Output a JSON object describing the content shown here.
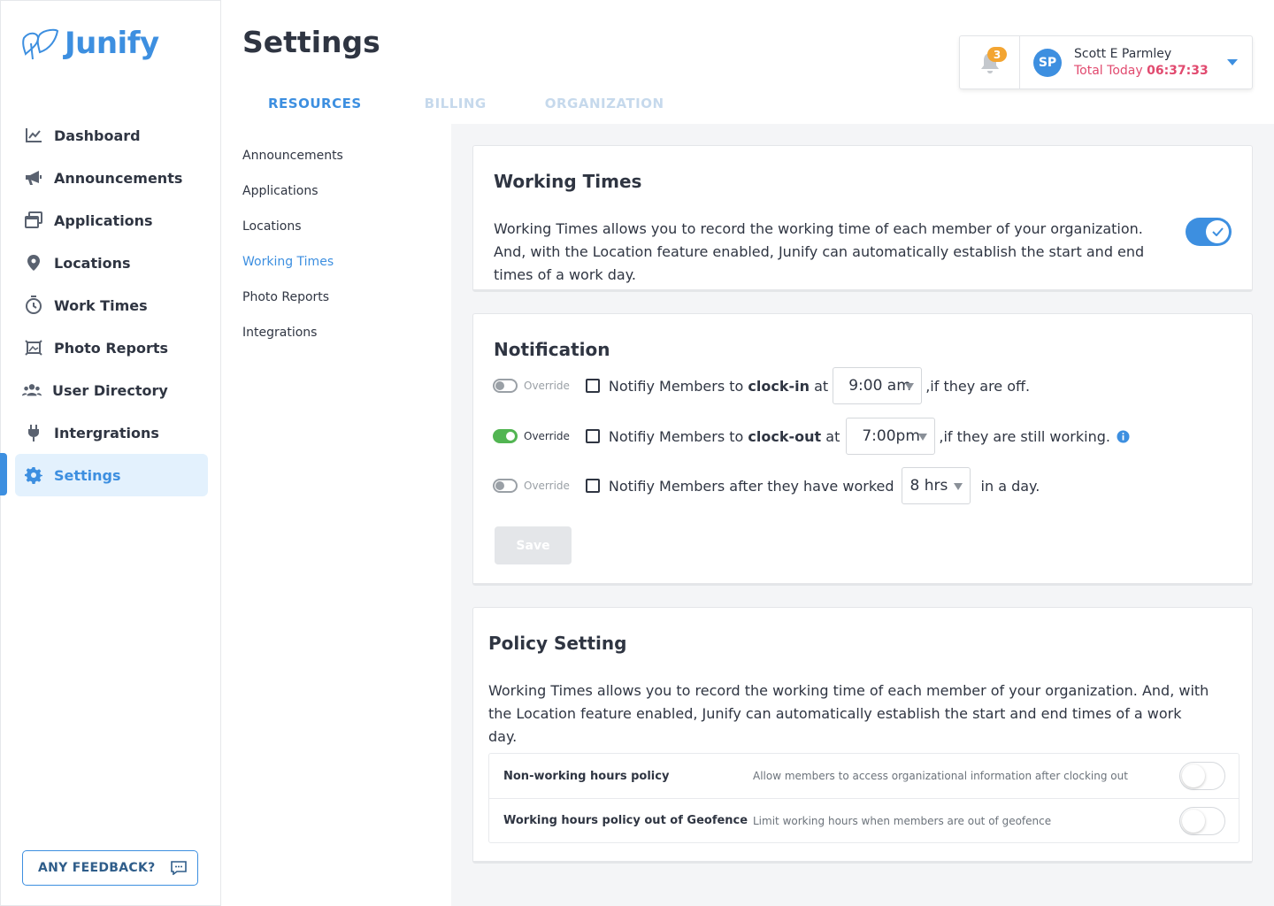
{
  "app": {
    "name": "Junify"
  },
  "sidebar": {
    "items": [
      {
        "label": "Dashboard",
        "icon": "chart-line-icon"
      },
      {
        "label": "Announcements",
        "icon": "megaphone-icon"
      },
      {
        "label": "Applications",
        "icon": "windows-icon"
      },
      {
        "label": "Locations",
        "icon": "map-pin-icon"
      },
      {
        "label": "Work Times",
        "icon": "stopwatch-icon"
      },
      {
        "label": "Photo Reports",
        "icon": "photo-frame-icon"
      },
      {
        "label": "User Directory",
        "icon": "users-icon"
      },
      {
        "label": "Intergrations",
        "icon": "plug-icon"
      },
      {
        "label": "Settings",
        "icon": "gear-icon",
        "active": true
      }
    ],
    "feedback_label": "ANY FEEDBACK?"
  },
  "header": {
    "title": "Settings",
    "tabs": [
      {
        "label": "RESOURCES",
        "active": true
      },
      {
        "label": "BILLING"
      },
      {
        "label": "ORGANIZATION"
      }
    ],
    "notifications_count": "3",
    "user": {
      "initials": "SP",
      "name": "Scott E Parmley",
      "total_label": "Total Today",
      "total_time": "06:37:33"
    }
  },
  "subnav": {
    "items": [
      "Announcements",
      "Applications",
      "Locations",
      "Working Times",
      "Photo Reports",
      "Integrations"
    ],
    "active": "Working Times"
  },
  "working_times": {
    "title": "Working Times",
    "description": "Working Times allows you to record the working time of each member of your organization. And, with the Location feature enabled, Junify can automatically establish the start and end times of a work day.",
    "enabled": true
  },
  "notification": {
    "title": "Notification",
    "override_label": "Override",
    "rows": [
      {
        "override_on": false,
        "prefix": "Notifiy Members to",
        "bold": "clock-in",
        "at": "at",
        "value": "9:00 am",
        "suffix": ",if they are off."
      },
      {
        "override_on": true,
        "prefix": "Notifiy Members to",
        "bold": "clock-out",
        "at": "at",
        "value": "7:00pm",
        "suffix": ",if they are still working."
      },
      {
        "override_on": false,
        "prefix": "Notifiy Members after they have worked",
        "value": "8 hrs",
        "suffix": "in a day."
      }
    ],
    "save_label": "Save"
  },
  "policy": {
    "title": "Policy Setting",
    "description": "Working Times allows you to record the working time of each member of your organization. And, with the Location feature enabled, Junify can automatically establish the start and end times of a work day.",
    "rows": [
      {
        "name": "Non-working hours policy",
        "desc": "Allow members to access organizational information after clocking out",
        "enabled": false
      },
      {
        "name": "Working hours policy out of Geofence",
        "desc": "Limit working hours when members are out of geofence",
        "enabled": false
      }
    ]
  },
  "colors": {
    "accent": "#3d8fe0",
    "badge": "#f3a532",
    "timer": "#e14a6f",
    "on": "#52b552"
  }
}
